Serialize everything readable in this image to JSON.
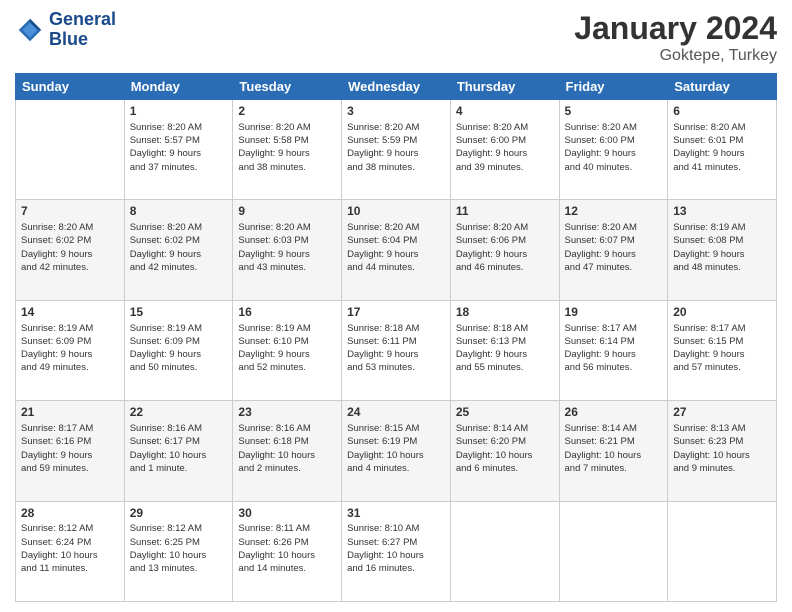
{
  "logo": {
    "line1": "General",
    "line2": "Blue"
  },
  "title": "January 2024",
  "location": "Goktepe, Turkey",
  "days_of_week": [
    "Sunday",
    "Monday",
    "Tuesday",
    "Wednesday",
    "Thursday",
    "Friday",
    "Saturday"
  ],
  "weeks": [
    [
      {
        "day": "",
        "content": ""
      },
      {
        "day": "1",
        "content": "Sunrise: 8:20 AM\nSunset: 5:57 PM\nDaylight: 9 hours\nand 37 minutes."
      },
      {
        "day": "2",
        "content": "Sunrise: 8:20 AM\nSunset: 5:58 PM\nDaylight: 9 hours\nand 38 minutes."
      },
      {
        "day": "3",
        "content": "Sunrise: 8:20 AM\nSunset: 5:59 PM\nDaylight: 9 hours\nand 38 minutes."
      },
      {
        "day": "4",
        "content": "Sunrise: 8:20 AM\nSunset: 6:00 PM\nDaylight: 9 hours\nand 39 minutes."
      },
      {
        "day": "5",
        "content": "Sunrise: 8:20 AM\nSunset: 6:00 PM\nDaylight: 9 hours\nand 40 minutes."
      },
      {
        "day": "6",
        "content": "Sunrise: 8:20 AM\nSunset: 6:01 PM\nDaylight: 9 hours\nand 41 minutes."
      }
    ],
    [
      {
        "day": "7",
        "content": ""
      },
      {
        "day": "8",
        "content": "Sunrise: 8:20 AM\nSunset: 6:02 PM\nDaylight: 9 hours\nand 42 minutes."
      },
      {
        "day": "9",
        "content": "Sunrise: 8:20 AM\nSunset: 6:03 PM\nDaylight: 9 hours\nand 43 minutes."
      },
      {
        "day": "10",
        "content": "Sunrise: 8:20 AM\nSunset: 6:04 PM\nDaylight: 9 hours\nand 44 minutes."
      },
      {
        "day": "11",
        "content": "Sunrise: 8:20 AM\nSunset: 6:06 PM\nDaylight: 9 hours\nand 46 minutes."
      },
      {
        "day": "12",
        "content": "Sunrise: 8:20 AM\nSunset: 6:07 PM\nDaylight: 9 hours\nand 47 minutes."
      },
      {
        "day": "13",
        "content": "Sunrise: 8:19 AM\nSunset: 6:08 PM\nDaylight: 9 hours\nand 48 minutes."
      }
    ],
    [
      {
        "day": "14",
        "content": ""
      },
      {
        "day": "15",
        "content": "Sunrise: 8:19 AM\nSunset: 6:09 PM\nDaylight: 9 hours\nand 50 minutes."
      },
      {
        "day": "16",
        "content": "Sunrise: 8:19 AM\nSunset: 6:10 PM\nDaylight: 9 hours\nand 52 minutes."
      },
      {
        "day": "17",
        "content": "Sunrise: 8:18 AM\nSunset: 6:11 PM\nDaylight: 9 hours\nand 53 minutes."
      },
      {
        "day": "18",
        "content": "Sunrise: 8:18 AM\nSunset: 6:13 PM\nDaylight: 9 hours\nand 55 minutes."
      },
      {
        "day": "19",
        "content": "Sunrise: 8:17 AM\nSunset: 6:14 PM\nDaylight: 9 hours\nand 56 minutes."
      },
      {
        "day": "20",
        "content": "Sunrise: 8:17 AM\nSunset: 6:15 PM\nDaylight: 9 hours\nand 57 minutes."
      }
    ],
    [
      {
        "day": "21",
        "content": ""
      },
      {
        "day": "22",
        "content": "Sunrise: 8:16 AM\nSunset: 6:17 PM\nDaylight: 10 hours\nand 1 minute."
      },
      {
        "day": "23",
        "content": "Sunrise: 8:16 AM\nSunset: 6:18 PM\nDaylight: 10 hours\nand 2 minutes."
      },
      {
        "day": "24",
        "content": "Sunrise: 8:15 AM\nSunset: 6:19 PM\nDaylight: 10 hours\nand 4 minutes."
      },
      {
        "day": "25",
        "content": "Sunrise: 8:14 AM\nSunset: 6:20 PM\nDaylight: 10 hours\nand 6 minutes."
      },
      {
        "day": "26",
        "content": "Sunrise: 8:14 AM\nSunset: 6:21 PM\nDaylight: 10 hours\nand 7 minutes."
      },
      {
        "day": "27",
        "content": "Sunrise: 8:13 AM\nSunset: 6:23 PM\nDaylight: 10 hours\nand 9 minutes."
      }
    ],
    [
      {
        "day": "28",
        "content": "Sunrise: 8:12 AM\nSunset: 6:24 PM\nDaylight: 10 hours\nand 11 minutes."
      },
      {
        "day": "29",
        "content": "Sunrise: 8:12 AM\nSunset: 6:25 PM\nDaylight: 10 hours\nand 13 minutes."
      },
      {
        "day": "30",
        "content": "Sunrise: 8:11 AM\nSunset: 6:26 PM\nDaylight: 10 hours\nand 14 minutes."
      },
      {
        "day": "31",
        "content": "Sunrise: 8:10 AM\nSunset: 6:27 PM\nDaylight: 10 hours\nand 16 minutes."
      },
      {
        "day": "",
        "content": ""
      },
      {
        "day": "",
        "content": ""
      },
      {
        "day": "",
        "content": ""
      }
    ]
  ],
  "week7_day14_content": "Sunrise: 8:19 AM\nSunset: 6:09 PM\nDaylight: 9 hours\nand 49 minutes.",
  "week4_day21_content": "Sunrise: 8:17 AM\nSunset: 6:16 PM\nDaylight: 9 hours\nand 59 minutes."
}
